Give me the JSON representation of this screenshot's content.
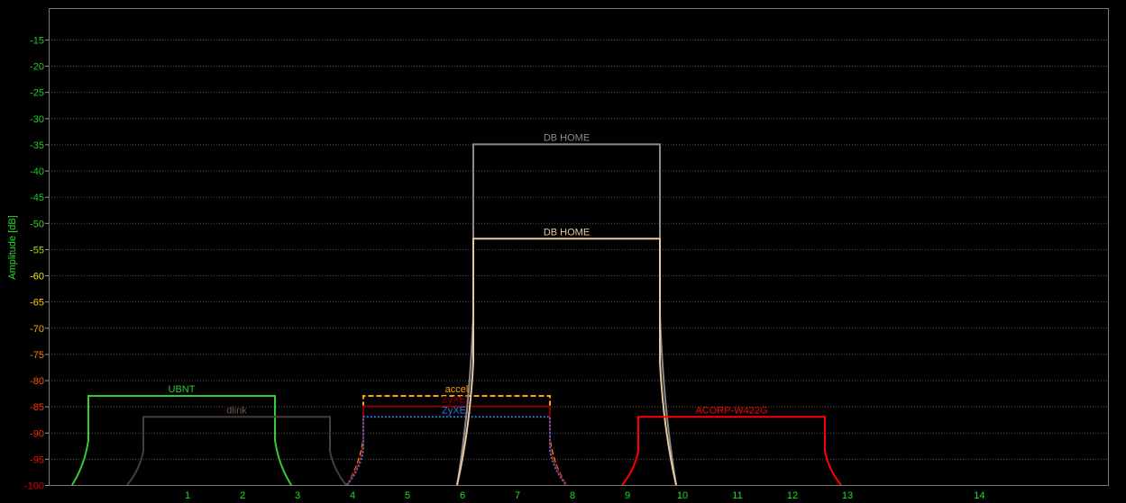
{
  "chart_data": {
    "type": "line",
    "title": "",
    "xlabel": "",
    "ylabel": "Amplitude [dB]",
    "ylim": [
      -100,
      -9
    ],
    "y_ticks": [
      -15,
      -20,
      -25,
      -30,
      -35,
      -40,
      -45,
      -50,
      -55,
      -60,
      -65,
      -70,
      -75,
      -80,
      -85,
      -90,
      -95,
      -100
    ],
    "y_tick_colors": [
      "#22cc22",
      "#22cc22",
      "#22cc22",
      "#22cc22",
      "#22cc22",
      "#22cc22",
      "#22cc22",
      "#44cc22",
      "#aadd22",
      "#eeee00",
      "#ffcc00",
      "#ffa500",
      "#ff8000",
      "#ff5500",
      "#ff3a00",
      "#ff2a00",
      "#ee1100",
      "#dd0000"
    ],
    "x_ticks": [
      {
        "label": "1",
        "channel": 1
      },
      {
        "label": "2",
        "channel": 2
      },
      {
        "label": "3",
        "channel": 3
      },
      {
        "label": "4",
        "channel": 4
      },
      {
        "label": "5",
        "channel": 5
      },
      {
        "label": "6",
        "channel": 6
      },
      {
        "label": "7",
        "channel": 7
      },
      {
        "label": "8",
        "channel": 8
      },
      {
        "label": "9",
        "channel": 9
      },
      {
        "label": "10",
        "channel": 10
      },
      {
        "label": "11",
        "channel": 11
      },
      {
        "label": "12",
        "channel": 12
      },
      {
        "label": "13",
        "channel": 13
      },
      {
        "label": "14",
        "channel": 14
      }
    ],
    "grid": true,
    "series": [
      {
        "name": "UBNT",
        "channel": 1,
        "level": -83,
        "color": "#33cc33",
        "style": "solid"
      },
      {
        "name": "dlink",
        "channel": 2,
        "level": -87,
        "color": "#4a3c3c",
        "label_color": "#6b5550",
        "style": "solid"
      },
      {
        "name": "accel",
        "channel": 6,
        "level": -83,
        "color": "#ffa500",
        "style": "dashed"
      },
      {
        "name": "ZyXEL",
        "channel": 6,
        "level": -85,
        "color": "#8b0000",
        "style": "solid"
      },
      {
        "name": "ZyXEL",
        "channel": 6,
        "level": -87,
        "color": "#3a6fe0",
        "style": "dotted"
      },
      {
        "name": "DB HOME",
        "channel": 8,
        "level": -35,
        "color": "#8a8a8a",
        "style": "solid"
      },
      {
        "name": "DB HOME",
        "channel": 8,
        "level": -53,
        "color": "#e6c89c",
        "style": "solid"
      },
      {
        "name": "ACORP-W422G",
        "channel": 11,
        "level": -87,
        "color": "#ff0000",
        "style": "solid"
      }
    ]
  }
}
